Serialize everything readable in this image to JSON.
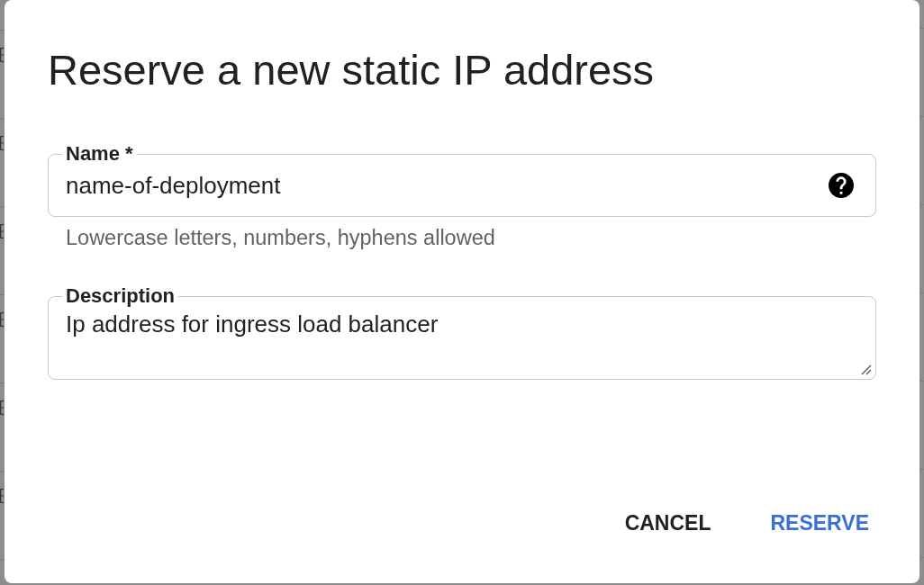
{
  "dialog": {
    "title": "Reserve a new static IP address",
    "fields": [
      {
        "kind": "text",
        "label": "Name *",
        "value": "name-of-deployment",
        "help_icon": true,
        "helper_text": "Lowercase letters, numbers, hyphens allowed"
      },
      {
        "kind": "textarea",
        "label": "Description",
        "value": "Ip address for ingress load balancer"
      }
    ],
    "buttons": [
      {
        "label": "CANCEL",
        "primary": false
      },
      {
        "label": "RESERVE",
        "primary": true
      }
    ]
  }
}
